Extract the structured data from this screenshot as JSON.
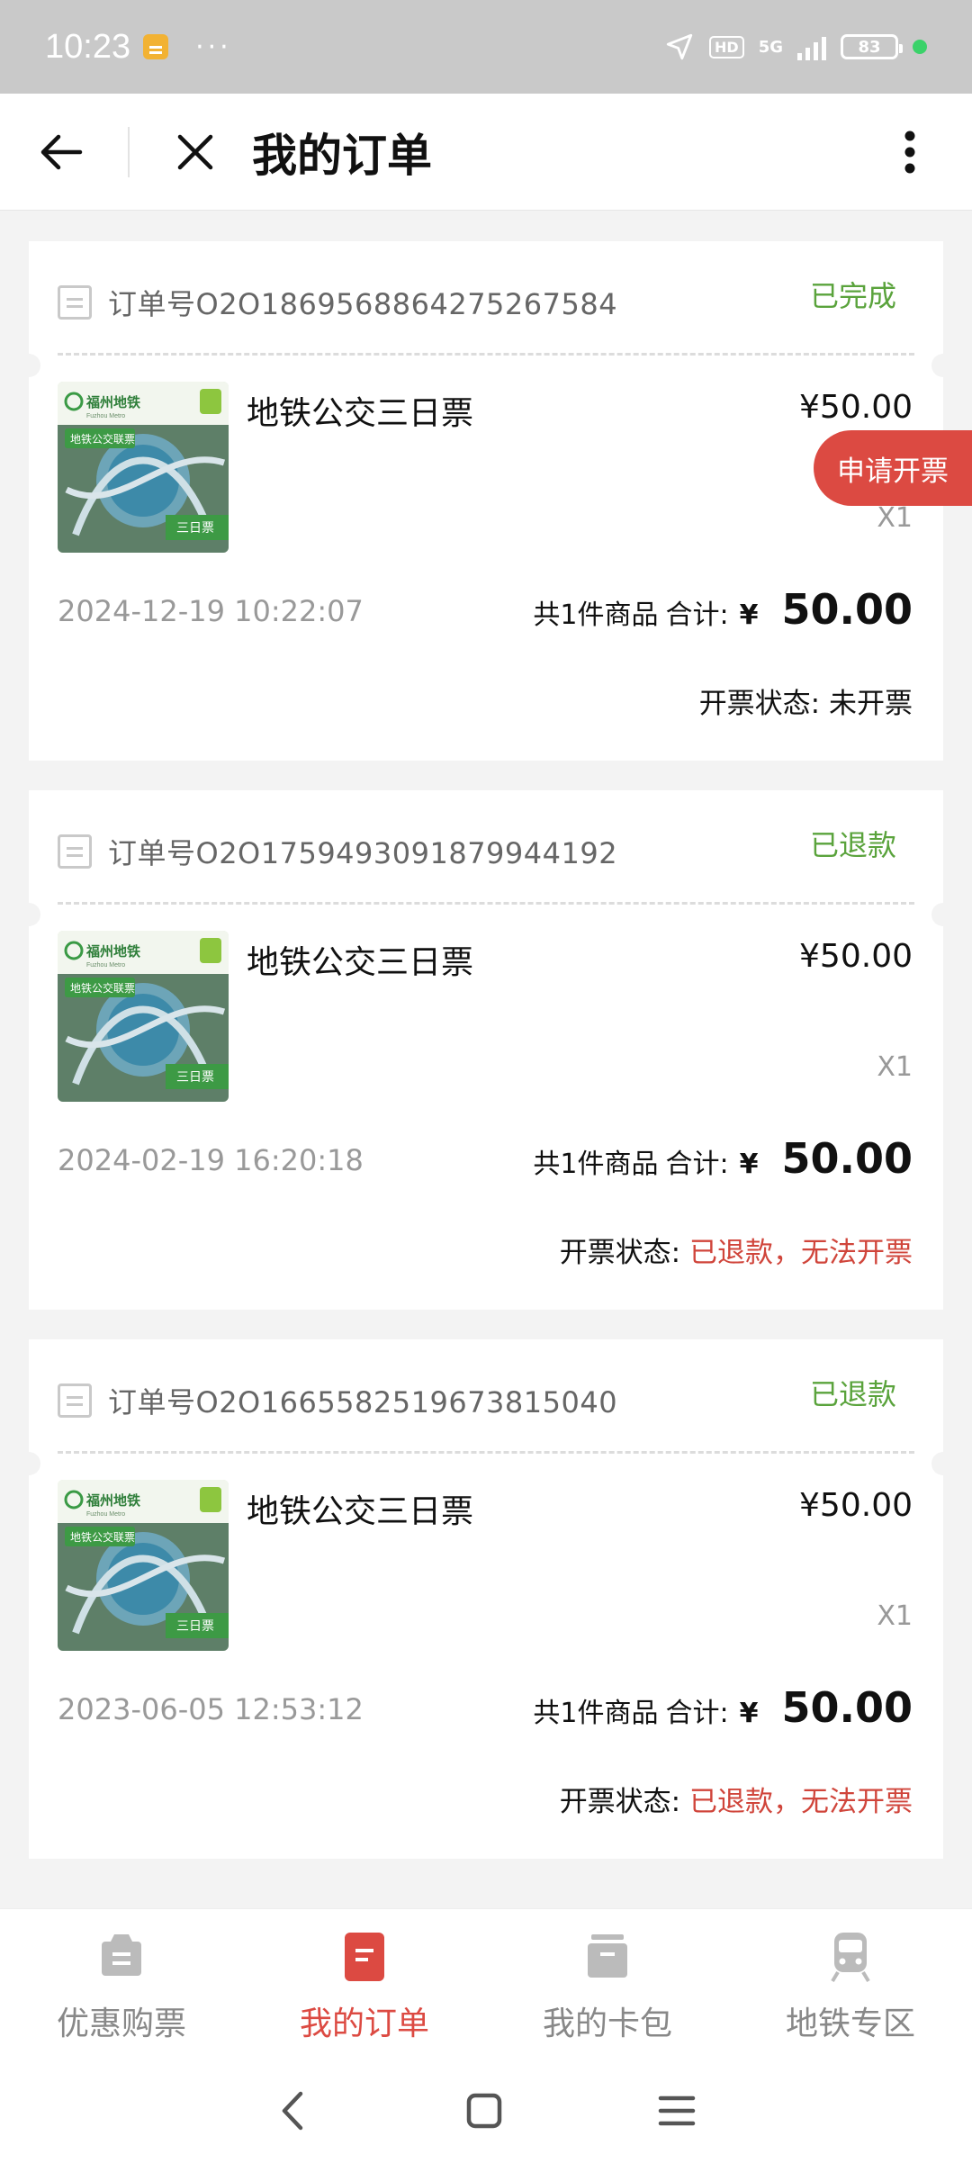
{
  "status_bar": {
    "time": "10:23",
    "dots": "···",
    "hd": "HD",
    "network": "5G",
    "battery": "83"
  },
  "header": {
    "title": "我的订单"
  },
  "orders": [
    {
      "order_no": "订单号O2O1869568864275267584",
      "status": "已完成",
      "product_name": "地铁公交三日票",
      "price": "¥50.00",
      "quantity": "X1",
      "time": "2024-12-19 10:22:07",
      "count_label": "共1件商品",
      "total_label": "合计:",
      "currency": "¥",
      "total": "50.00",
      "invoice_label": "开票状态:",
      "invoice_value": "未开票",
      "invoice_value_color": "#111111"
    },
    {
      "order_no": "订单号O2O1759493091879944192",
      "status": "已退款",
      "product_name": "地铁公交三日票",
      "price": "¥50.00",
      "quantity": "X1",
      "time": "2024-02-19 16:20:18",
      "count_label": "共1件商品",
      "total_label": "合计:",
      "currency": "¥",
      "total": "50.00",
      "invoice_label": "开票状态:",
      "invoice_value": "已退款，无法开票",
      "invoice_value_color": "#d0453b"
    },
    {
      "order_no": "订单号O2O1665582519673815040",
      "status": "已退款",
      "product_name": "地铁公交三日票",
      "price": "¥50.00",
      "quantity": "X1",
      "time": "2023-06-05 12:53:12",
      "count_label": "共1件商品",
      "total_label": "合计:",
      "currency": "¥",
      "total": "50.00",
      "invoice_label": "开票状态:",
      "invoice_value": "已退款，无法开票",
      "invoice_value_color": "#d0453b"
    }
  ],
  "thumbnail": {
    "brand": "福州地铁",
    "sub_brand": "Fuzhou Metro",
    "tag": "地铁公交联票",
    "badge": "三日票"
  },
  "floating_button": {
    "label": "申请开票"
  },
  "tabs": [
    {
      "label": "优惠购票",
      "icon": "ticket-icon",
      "active": false
    },
    {
      "label": "我的订单",
      "icon": "order-icon",
      "active": true
    },
    {
      "label": "我的卡包",
      "icon": "wallet-icon",
      "active": false
    },
    {
      "label": "地铁专区",
      "icon": "train-icon",
      "active": false
    }
  ],
  "colors": {
    "accent": "#dc4a42",
    "status_green": "#5aa33c",
    "muted": "#999999"
  }
}
